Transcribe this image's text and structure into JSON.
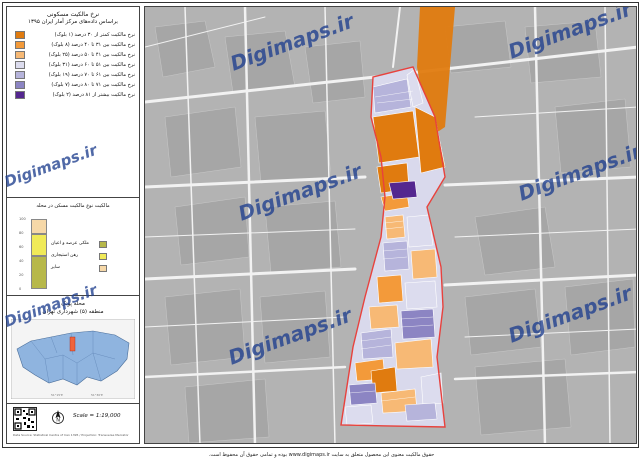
{
  "legend": {
    "title": "نرخ مالکیت مسکونی",
    "subtitle": "براساس داده‌های مرکز آمار ایران ۱۳۹۵",
    "items": [
      {
        "label": "نرخ مالکیت کمتر از ۳۰ درصد (۱ بلوک)",
        "color": "#e07b0f"
      },
      {
        "label": "نرخ مالکیت بین ۳۱ تا ۴۰ درصد (۸ بلوک)",
        "color": "#f39a3a"
      },
      {
        "label": "نرخ مالکیت بین ۴۱ تا ۵۰ درصد (۲۵ بلوک)",
        "color": "#f7b975"
      },
      {
        "label": "نرخ مالکیت بین ۵۱ تا ۶۰ درصد (۳۱ بلوک)",
        "color": "#dcdcee"
      },
      {
        "label": "نرخ مالکیت بین ۶۱ تا ۷۰ درصد (۱۹ بلوک)",
        "color": "#b6b4db"
      },
      {
        "label": "نرخ مالکیت بین ۷۱ تا ۸۰ درصد (۷ بلوک)",
        "color": "#8c85c3"
      },
      {
        "label": "نرخ مالکیت بیشتر از ۸۱ درصد (۲ بلوک)",
        "color": "#54278f"
      }
    ]
  },
  "bar_chart": {
    "title": "مالکیت نوع مالکیت مسکن در محله",
    "yticks": [
      "100",
      "80",
      "60",
      "40",
      "20",
      "0"
    ],
    "segments": [
      {
        "label": "ملکی عرصه و اعیان",
        "color": "#b7b84a",
        "share": 0.47
      },
      {
        "label": "رهن استیجاری",
        "color": "#f0ea58",
        "share": 0.32
      },
      {
        "label": "سایر",
        "color": "#f6d8a8",
        "share": 0.21
      }
    ]
  },
  "area": {
    "line1": "محله پونک",
    "line2": "منطقه (۵) شهرداری تهران"
  },
  "scale_text": "Scale = 1:19,000",
  "credit_text": "Data Source: Statistical Centre of Iran 1395 / Projection: Transverse Mercator",
  "footer_text": "حقوق مالکیت معنوی این محصول متعلق به سایت www.digimaps.ir بوده و تمامی حقوق آن محفوظ است.",
  "watermark": "Digimaps.ir",
  "colors": {
    "background_map": "#b5b5b5",
    "roads": "#f2f2f2",
    "boundary": "#e8423d",
    "highlight": "#e07b0f"
  }
}
